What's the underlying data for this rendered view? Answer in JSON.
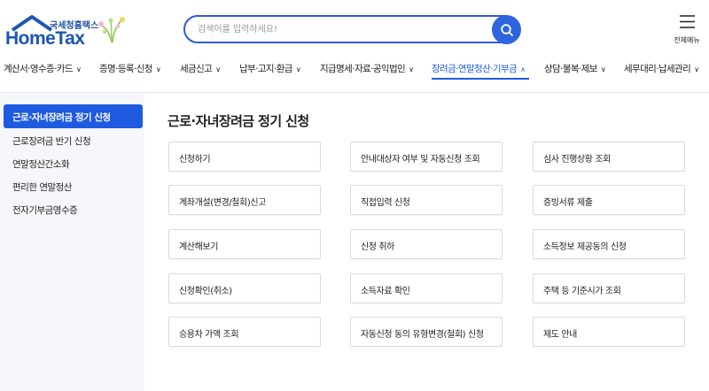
{
  "brand": {
    "korean": "국세청홈택스",
    "english": "HomeTax"
  },
  "search": {
    "placeholder": "검색어를 입력하세요!",
    "icon": "search-icon"
  },
  "all_menu": {
    "label": "전체메뉴",
    "icon": "hamburger-icon"
  },
  "nav": [
    {
      "label": "계산서·영수증·카드"
    },
    {
      "label": "증명·등록·신청"
    },
    {
      "label": "세금신고"
    },
    {
      "label": "납부·고지·환급"
    },
    {
      "label": "지급명세·자료·공익법인"
    },
    {
      "label": "장려금·연말정산·기부금"
    },
    {
      "label": "상담·불복·제보"
    },
    {
      "label": "세무대리·납세관리"
    }
  ],
  "sidebar": {
    "items": [
      {
        "label": "근로·자녀장려금 정기 신청"
      },
      {
        "label": "근로장려금 반기 신청"
      },
      {
        "label": "연말정산간소화"
      },
      {
        "label": "편리한 연말정산"
      },
      {
        "label": "전자기부금영수증"
      }
    ]
  },
  "main": {
    "title": "근로·자녀장려금 정기 신청",
    "buttons": [
      {
        "label": "신청하기"
      },
      {
        "label": "안내대상자 여부 및 자동신청 조회"
      },
      {
        "label": "심사 진행상황 조회"
      },
      {
        "label": "계좌개설(변경/철회)신고"
      },
      {
        "label": "직접입력 신청"
      },
      {
        "label": "증빙서류 제출"
      },
      {
        "label": "계산해보기"
      },
      {
        "label": "신청 취하"
      },
      {
        "label": "소득정보 제공동의 신청"
      },
      {
        "label": "신청확인(취소)"
      },
      {
        "label": "소득자료 확인"
      },
      {
        "label": "주택 등 기준시가 조회"
      },
      {
        "label": "승용차 가액 조회"
      },
      {
        "label": "자동신청 동의 유형변경(철회) 신청"
      },
      {
        "label": "제도 안내"
      }
    ]
  },
  "colors": {
    "accent": "#1f5be0",
    "sidebar_bg": "#f5f7fa",
    "border": "#d7dce3"
  }
}
